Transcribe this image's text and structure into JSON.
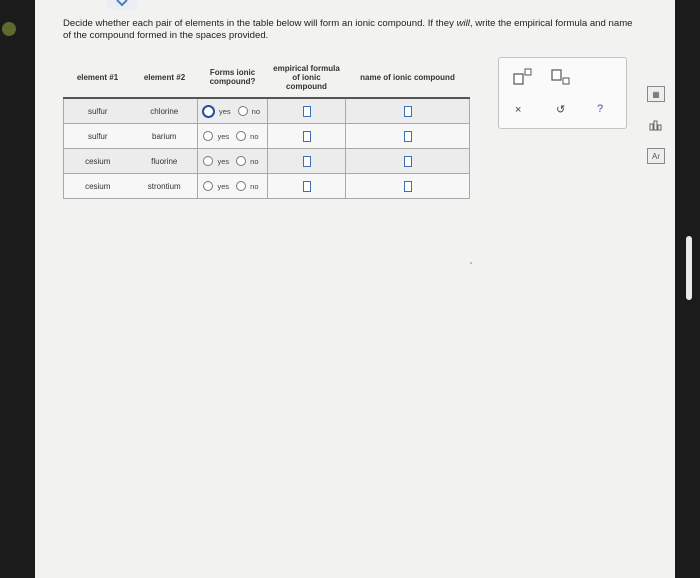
{
  "instructions": {
    "part1": "Decide whether each pair of elements in the table below will form an ionic compound. If they ",
    "will": "will",
    "part2": ", write the empirical formula and name of the compound formed in the spaces provided."
  },
  "table": {
    "headers": {
      "element1": "element #1",
      "element2": "element #2",
      "forms_ionic": "Forms ionic compound?",
      "formula": "empirical formula of ionic compound",
      "name": "name of ionic compound"
    },
    "rows": [
      {
        "element1": "sulfur",
        "element2": "chlorine",
        "selected": "yes"
      },
      {
        "element1": "sulfur",
        "element2": "barium",
        "selected": ""
      },
      {
        "element1": "cesium",
        "element2": "fluorine",
        "selected": ""
      },
      {
        "element1": "cesium",
        "element2": "strontium",
        "selected": ""
      }
    ],
    "radio_yes": "yes",
    "radio_no": "no"
  },
  "panel": {
    "clear_symbol": "×",
    "undo_symbol": "↺",
    "help_symbol": "?"
  },
  "colors": {
    "accent": "#1f4fa3",
    "answer_box": "#3c6fb8",
    "help": "#6a3ea1"
  }
}
